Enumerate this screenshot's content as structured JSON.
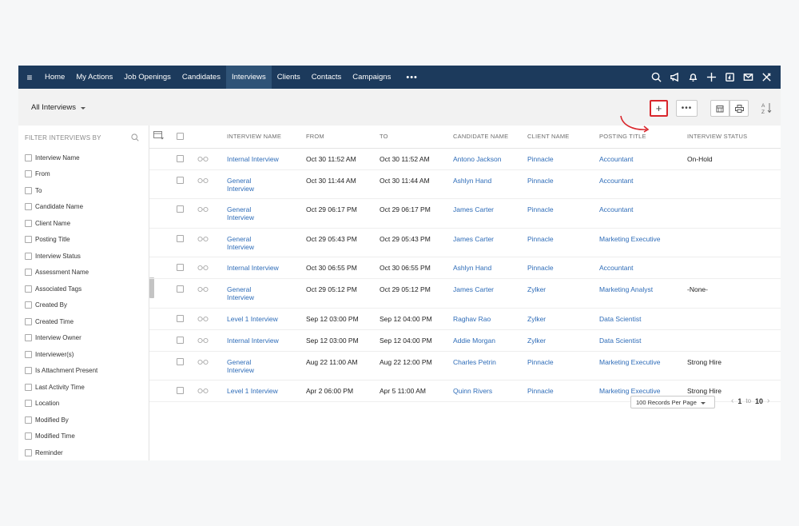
{
  "nav": {
    "items": [
      "Home",
      "My Actions",
      "Job Openings",
      "Candidates",
      "Interviews",
      "Clients",
      "Contacts",
      "Campaigns"
    ],
    "active": "Interviews",
    "more_label": "•••"
  },
  "toolbar": {
    "view_label": "All Interviews",
    "add_label": "+",
    "more_label": "•••"
  },
  "sidebar": {
    "heading": "FILTER INTERVIEWS BY",
    "filters": [
      "Interview Name",
      "From",
      "To",
      "Candidate Name",
      "Client Name",
      "Posting Title",
      "Interview Status",
      "Assessment Name",
      "Associated Tags",
      "Created By",
      "Created Time",
      "Interview Owner",
      "Interviewer(s)",
      "Is Attachment Present",
      "Last Activity Time",
      "Location",
      "Modified By",
      "Modified Time",
      "Reminder"
    ]
  },
  "table": {
    "columns": [
      "INTERVIEW NAME",
      "FROM",
      "TO",
      "CANDIDATE NAME",
      "CLIENT NAME",
      "POSTING TITLE",
      "INTERVIEW STATUS"
    ],
    "rows": [
      {
        "name": "Internal Interview",
        "from": "Oct 30 11:52 AM",
        "to": "Oct 30 11:52 AM",
        "candidate": "Antono Jackson",
        "client": "Pinnacle",
        "posting": "Accountant",
        "status": "On-Hold"
      },
      {
        "name": "General Interview",
        "from": "Oct 30 11:44 AM",
        "to": "Oct 30 11:44 AM",
        "candidate": "Ashlyn Hand",
        "client": "Pinnacle",
        "posting": "Accountant",
        "status": ""
      },
      {
        "name": "General Interview",
        "from": "Oct 29 06:17 PM",
        "to": "Oct 29 06:17 PM",
        "candidate": "James Carter",
        "client": "Pinnacle",
        "posting": "Accountant",
        "status": ""
      },
      {
        "name": "General Interview",
        "from": "Oct 29 05:43 PM",
        "to": "Oct 29 05:43 PM",
        "candidate": "James Carter",
        "client": "Pinnacle",
        "posting": "Marketing Executive",
        "status": ""
      },
      {
        "name": "Internal Interview",
        "from": "Oct 30 06:55 PM",
        "to": "Oct 30 06:55 PM",
        "candidate": "Ashlyn Hand",
        "client": "Pinnacle",
        "posting": "Accountant",
        "status": ""
      },
      {
        "name": "General Interview",
        "from": "Oct 29 05:12 PM",
        "to": "Oct 29 05:12 PM",
        "candidate": "James Carter",
        "client": "Zylker",
        "posting": "Marketing Analyst",
        "status": "-None-"
      },
      {
        "name": "Level 1 Interview",
        "from": "Sep 12 03:00 PM",
        "to": "Sep 12 04:00 PM",
        "candidate": "Raghav Rao",
        "client": "Zylker",
        "posting": "Data Scientist",
        "status": ""
      },
      {
        "name": "Internal Interview",
        "from": "Sep 12 03:00 PM",
        "to": "Sep 12 04:00 PM",
        "candidate": "Addie Morgan",
        "client": "Zylker",
        "posting": "Data Scientist",
        "status": ""
      },
      {
        "name": "General Interview",
        "from": "Aug 22 11:00 AM",
        "to": "Aug 22 12:00 PM",
        "candidate": "Charles Petrin",
        "client": "Pinnacle",
        "posting": "Marketing Executive",
        "status": "Strong Hire"
      },
      {
        "name": "Level 1 Interview",
        "from": "Apr 2 06:00 PM",
        "to": "Apr 5 11:00 AM",
        "candidate": "Quinn Rivers",
        "client": "Pinnacle",
        "posting": "Marketing Executive",
        "status": "Strong Hire"
      }
    ]
  },
  "footer": {
    "per_page": "100 Records Per Page",
    "page_from": "1",
    "page_sep": "to",
    "page_to": "10"
  },
  "colors": {
    "nav_bg": "#1c3a5c",
    "link": "#2e6cb8",
    "annotation": "#d9262c"
  }
}
